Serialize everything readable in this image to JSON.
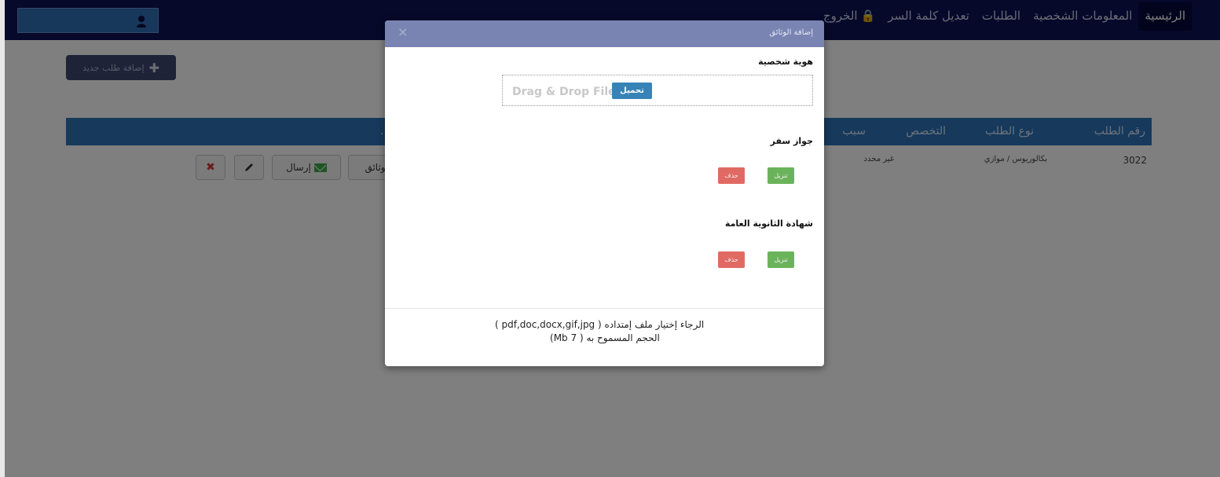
{
  "navbar": {
    "links": [
      {
        "label": "الرئيسية",
        "active": true
      },
      {
        "label": "المعلومات الشخصية",
        "active": false
      },
      {
        "label": "الطلبات",
        "active": false
      },
      {
        "label": "تعديل كلمة السر",
        "active": false
      },
      {
        "label": "الخروج",
        "active": false
      }
    ],
    "user_box": {
      "icon": "user-icon",
      "color": "#2f6eb6"
    }
  },
  "page": {
    "add_button_label": "إضافة طلب جديد",
    "table": {
      "headers": [
        "رقم الطلب",
        "نوع الطلب",
        "التخصص",
        "سبب",
        "..."
      ],
      "row": {
        "number": "3022",
        "type": "بكالوريوس / موازي",
        "major": "غير محدد",
        "send_label": "إرسال",
        "docs_label": "الوثائق"
      }
    }
  },
  "modal": {
    "title": "إضافة الوثائق",
    "close_icon": "×",
    "sections": [
      {
        "title": "هوية شخصية",
        "drop_text": "Drag & Drop Files",
        "upload_label": "تحميل"
      },
      {
        "title": "جواز سفر",
        "download_label": "تنزيل",
        "delete_label": "حذف"
      },
      {
        "title": "شهادة الثانوية العامة",
        "download_label": "تنزيل",
        "delete_label": "حذف"
      }
    ],
    "footer_line1": "الرجاء إختيار ملف إمتداده ( pdf,doc,docx,gif,jpg )",
    "footer_line2": "الحجم المسموح به ( 7 Mb)"
  },
  "colors": {
    "navbar": "#0d1255",
    "table_header": "#2d73b8",
    "modal_header": "#7984b2",
    "download": "#6bb35a",
    "delete": "#e06a63",
    "upload": "#3783b8"
  }
}
